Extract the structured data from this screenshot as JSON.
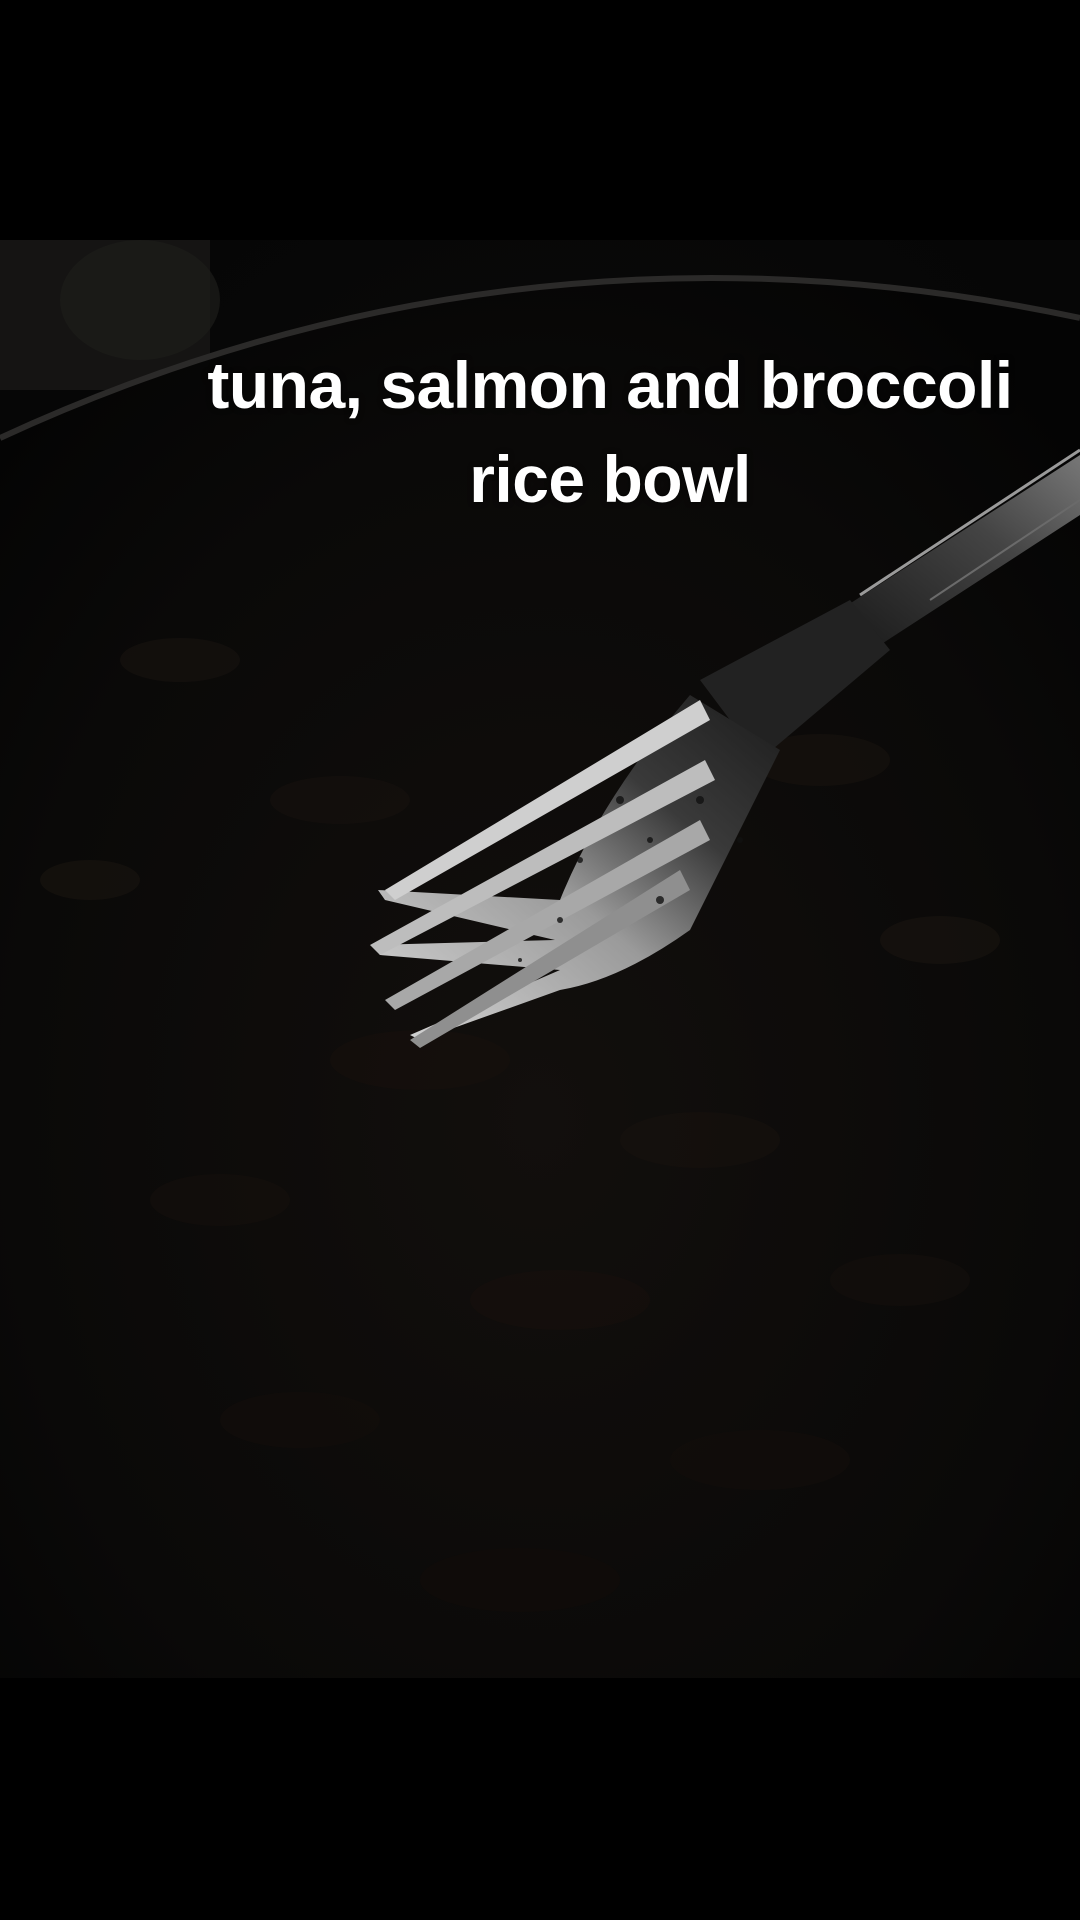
{
  "video": {
    "caption": "tuna, salmon and broccoli\nrice bowl"
  },
  "scene": {
    "subject_icon": "fork-icon",
    "background_color": "#000000"
  }
}
